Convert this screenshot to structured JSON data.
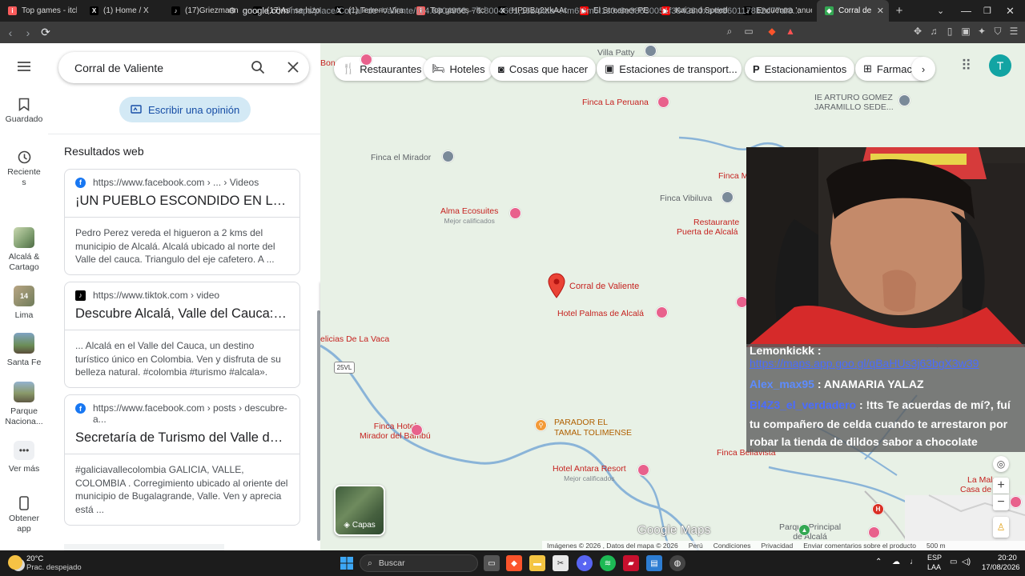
{
  "browser": {
    "tabs": [
      {
        "title": "Top games - itch.io",
        "color": "#fa5c5c",
        "glyph": "i"
      },
      {
        "title": "(1) Home / X",
        "color": "#000000",
        "glyph": "X"
      },
      {
        "title": "(17)Griezmann edit",
        "color": "#000000",
        "glyph": "♪"
      },
      {
        "title": "(17)Así se hizo la p",
        "color": "#000000",
        "glyph": "♪"
      },
      {
        "title": "(1) Terreno Viral on",
        "color": "#000000",
        "glyph": "X"
      },
      {
        "title": "Top games - itch.io",
        "color": "#fa5c5c",
        "glyph": "i"
      },
      {
        "title": "HP9rBq2XkAAq4Os",
        "color": "#000000",
        "glyph": "X"
      },
      {
        "title": "El Streamer PERUA",
        "color": "#ff0000",
        "glyph": "▶"
      },
      {
        "title": "Kai and Speed Min",
        "color": "#ff0000",
        "glyph": "▶"
      },
      {
        "title": "Encuentra 'anuel a",
        "color": "#000000",
        "glyph": "♪"
      },
      {
        "title": "Corral de Valie",
        "color": "#34a853",
        "glyph": "◆",
        "active": true
      }
    ],
    "url_domain": "google.com",
    "url_path": "/maps/place/Corral+de+Valiente/@4.6904968,-75.8004661,15z/data=!4m6!3m5!1s0x8e38630051f38423:0xa4b8601178b2d77a!8..."
  },
  "rail": {
    "items": [
      {
        "label": "Guardado"
      },
      {
        "label": "Recientes"
      },
      {
        "label": "Alcalá & Cartago"
      },
      {
        "label": "Lima",
        "badge": "14"
      },
      {
        "label": "Santa Fe"
      },
      {
        "label": "Parque Naciona..."
      },
      {
        "label": "Ver más"
      },
      {
        "label": "Obtener app"
      }
    ]
  },
  "panel": {
    "search_value": "Corral de Valiente",
    "review_button": "Escribir una opinión",
    "section_title": "Resultados web",
    "results": [
      {
        "source": "https://www.facebook.com › ... › Videos",
        "title": "¡UN PUEBLO ESCONDIDO EN LOS...",
        "description": "Pedro Perez vereda el higueron a 2 kms del municipio de Alcalá. Alcalá ubicado al norte del Valle del cauca. Triangulo del eje cafetero. A ...",
        "favicon": "facebook"
      },
      {
        "source": "https://www.tiktok.com › video",
        "title": "Descubre Alcalá, Valle del Cauca: Un ...",
        "description": "... Alcalá en el Valle del Cauca, un destino turístico único en Colombia. Ven y disfruta de su belleza natural. #colombia #turismo #alcala».",
        "favicon": "tiktok"
      },
      {
        "source": "https://www.facebook.com › posts › descubre-a...",
        "title": "Secretaría de Turismo del Valle del ...",
        "description": "#galiciavallecolombia GALICIA, VALLE, COLOMBIA . Corregimiento ubicado al oriente del municipio de Bugalagrande, Valle. Ven y aprecia está ...",
        "favicon": "facebook"
      }
    ]
  },
  "map": {
    "chips": [
      {
        "label": "Restaurantes",
        "icon": "fork-knife-icon"
      },
      {
        "label": "Hoteles",
        "icon": "bed-icon"
      },
      {
        "label": "Cosas que hacer",
        "icon": "camera-icon"
      },
      {
        "label": "Estaciones de transport...",
        "icon": "bus-icon"
      },
      {
        "label": "Estacionamientos",
        "icon": "parking-icon"
      },
      {
        "label": "Farmaci",
        "icon": "pharmacy-icon"
      }
    ],
    "account_initial": "T",
    "places": {
      "villa_patty": "Villa Patty",
      "bon": "Bon",
      "finca_peruana": "Finca La Peruana",
      "arturo_1": "IE ARTURO GOMEZ",
      "arturo_2": "JARAMILLO SEDE...",
      "finca_mirador": "Finca el Mirador",
      "finca_ma": "Finca Ma",
      "finca_vibiluva": "Finca Vibiluva",
      "alma": "Alma Ecosuites",
      "alma_sub": "Mejor calificados",
      "rest_1": "Restaurante",
      "rest_2": "Puerta de Alcalá",
      "corral": "Corral de Valiente",
      "palmas": "Hotel Palmas de Alcalá",
      "delicias": "elicias De La Vaca",
      "route": "25VL",
      "finca_hotel_1": "Finca Hotel",
      "finca_hotel_2": "Mirador del Bambú",
      "parador_1": "PARADOR EL",
      "parador_2": "TAMAL TOLIMENSE",
      "antara": "Hotel Antara Resort",
      "antara_sub": "Mejor calificados",
      "bellavista": "Finca Bellavista",
      "malaga_1": "La Malaga",
      "malaga_2": "Casa de Ca",
      "parque_1": "Parque Principal",
      "parque_2": "de Alcalá"
    },
    "layers_label": "Capas",
    "logo": "Google Maps",
    "attribution": [
      "Imágenes © 2026 , Datos del mapa © 2026",
      "Perú",
      "Condiciones",
      "Privacidad",
      "Enviar comentarios sobre el producto",
      "500 m"
    ]
  },
  "chat": {
    "lines": [
      {
        "user": "Lemonkickk",
        "text": ":",
        "user_color": "#ffffff"
      },
      {
        "user": "",
        "text": "https://maps.app.goo.gl/qBaHUs3j63bgX3w39",
        "user_color": "#4a6cff"
      },
      {
        "user": "Alex_max95",
        "text": ": ANAMARIA YALAZ",
        "user_color": "#5d8cff"
      },
      {
        "user": "Bl4Z3_el_verdadero",
        "text": ": !tts Te acuerdas de mí?, fuí",
        "user_color": "#4a6cff"
      },
      {
        "user": "",
        "text": "tu compañero de celda cuando te arrestaron por",
        "user_color": "#ffffff"
      },
      {
        "user": "",
        "text": "robar la tienda de dildos sabor a chocolate",
        "user_color": "#ffffff"
      }
    ]
  },
  "taskbar": {
    "weather_temp": "20°C",
    "weather_desc": "Prac. despejado",
    "search_placeholder": "Buscar",
    "lang_1": "ESP",
    "lang_2": "LAA",
    "time": "20:20",
    "date": "17/08/2026"
  }
}
